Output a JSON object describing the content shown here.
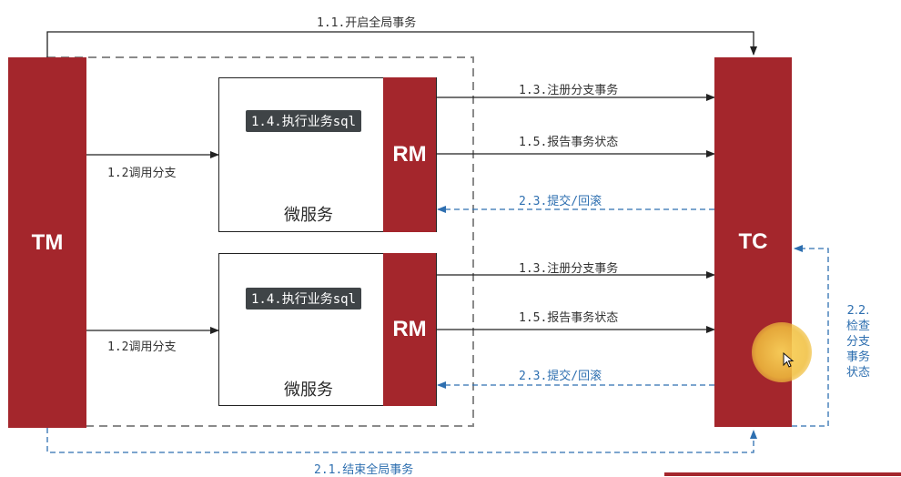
{
  "nodes": {
    "tm": "TM",
    "tc": "TC",
    "rm": "RM",
    "service": "微服务",
    "sql_tag": "1.4.执行业务sql"
  },
  "labels": {
    "begin_global": "1.1.开启全局事务",
    "call_branch": "1.2调用分支",
    "register_branch": "1.3.注册分支事务",
    "report_status": "1.5.报告事务状态",
    "commit_rollback": "2.3.提交/回滚",
    "end_global": "2.1.结束全局事务",
    "check_status": [
      "2.2.",
      "检查",
      "分支",
      "事务",
      "状态"
    ]
  },
  "colors": {
    "block": "#a4262c",
    "solid_arrow": "#222222",
    "dashed_arrow": "#2e6fb0",
    "dashed_boundary": "#8a8a8a",
    "sql_tag_bg": "#3f4447"
  }
}
